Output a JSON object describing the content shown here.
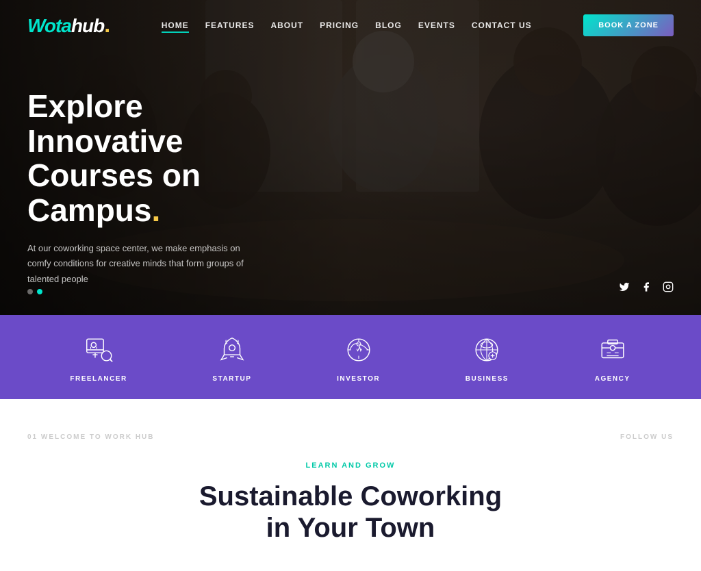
{
  "logo": {
    "wota": "Wota",
    "hub": "hub",
    "dot": "."
  },
  "nav": {
    "links": [
      {
        "label": "HOME",
        "active": true
      },
      {
        "label": "FEATURES",
        "active": false
      },
      {
        "label": "ABOUT",
        "active": false
      },
      {
        "label": "PRICING",
        "active": false
      },
      {
        "label": "BLOG",
        "active": false
      },
      {
        "label": "EVENTS",
        "active": false
      },
      {
        "label": "CONTACT US",
        "active": false
      }
    ],
    "cta": "BOOK A ZONE"
  },
  "hero": {
    "title_line1": "Explore Innovative",
    "title_line2": "Courses on Campus",
    "accent_dot": ".",
    "subtitle": "At our coworking space center, we make emphasis on comfy conditions for creative minds that form groups of talented people"
  },
  "categories": [
    {
      "label": "FREELANCER",
      "icon": "freelancer"
    },
    {
      "label": "STARTUP",
      "icon": "startup"
    },
    {
      "label": "INVESTOR",
      "icon": "investor"
    },
    {
      "label": "BUSINESS",
      "icon": "business"
    },
    {
      "label": "AGENCY",
      "icon": "agency"
    }
  ],
  "section_below": {
    "label_left": "01 WELCOME TO WORK HUB",
    "label_right": "FOLLOW US",
    "tag": "LEARN AND GROW",
    "title_line1": "Sustainable Coworking",
    "title_line2": "in Your Town"
  },
  "social": {
    "twitter": "𝕏",
    "facebook": "f",
    "instagram": "◎"
  },
  "dots": [
    {
      "active": false
    },
    {
      "active": true
    }
  ]
}
